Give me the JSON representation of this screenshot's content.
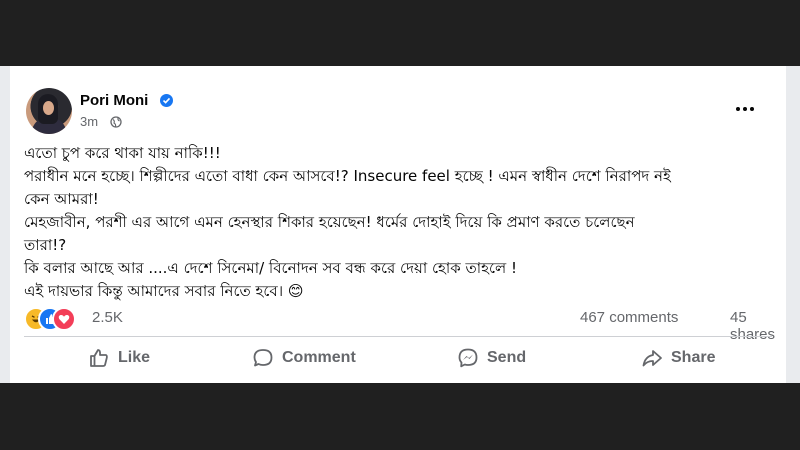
{
  "post": {
    "author": "Pori Moni",
    "time": "3m",
    "verified": true,
    "text_lines": [
      "এতো চুপ করে থাকা যায় নাকি!!!",
      "পরাধীন মনে হচ্ছে। শিল্পীদের এতো বাধা কেন আসবে!? Insecure feel হচ্ছে ! এমন স্বাধীন দেশে নিরাপদ নই",
      "কেন আমরা!",
      "মেহজাবীন, পরশী এর আগে এমন হেনস্থার শিকার হয়েছেন! ধর্মের দোহাই দিয়ে কি প্রমাণ করতে চলেছেন",
      "তারা!?",
      "কি বলার আছে আর ....এ দেশে সিনেমা/ বিনোদন সব বন্ধ করে দেয়া হোক তাহলে !",
      "এই দায়ভার কিন্তু আমাদের সবার নিতে হবে। 😊"
    ],
    "reactions_count": "2.5K",
    "comments_count": "467 comments",
    "shares_count": "45 shares"
  },
  "actions": {
    "like": "Like",
    "comment": "Comment",
    "send": "Send",
    "share": "Share"
  },
  "icons": {
    "verified": "verified-badge-icon",
    "privacy": "globe-icon",
    "more": "more-options-icon",
    "reactions": [
      "haha-icon",
      "like-reaction-icon",
      "love-reaction-icon"
    ]
  },
  "colors": {
    "brand": "#1877f2",
    "secondary_text": "#65676b",
    "text": "#050505"
  }
}
